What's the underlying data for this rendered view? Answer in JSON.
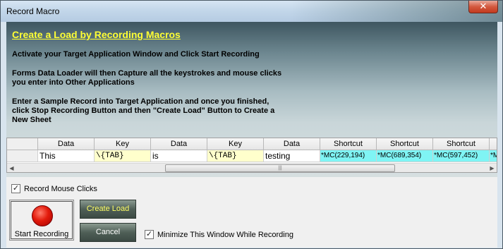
{
  "window": {
    "title": "Record Macro",
    "close_glyph": "✕"
  },
  "banner": {
    "heading": "Create a Load by Recording Macros",
    "line1": "Activate your Target Application Window and Click Start Recording",
    "line2a": "Forms Data Loader will then Capture all the keystrokes and mouse clicks",
    "line2b": "you enter into Other Applications",
    "line3a": "Enter a Sample Record into Target Application and once you finished,",
    "line3b": "click Stop Recording Button and then \"Create Load\" Button to Create a",
    "line3c": "New Sheet"
  },
  "grid": {
    "headers": [
      "Data",
      "Key",
      "Data",
      "Key",
      "Data",
      "Shortcut",
      "Shortcut",
      "Shortcut"
    ],
    "row": [
      "This",
      "\\{TAB}",
      "is",
      "\\{TAB}",
      "testing",
      "*MC(229,194)",
      "*MC(689,354)",
      "*MC(597,452)",
      "*M"
    ],
    "scroll_left": "◀",
    "scroll_right": "▶",
    "scroll_grip": "|||"
  },
  "options": {
    "record_mouse_clicks": "Record Mouse Clicks",
    "record_mouse_checked": "✓",
    "minimize_label": "Minimize This Window While Recording",
    "minimize_checked": "✓"
  },
  "buttons": {
    "start_recording": "Start Recording",
    "create_load": "Create Load",
    "cancel": "Cancel"
  },
  "colors": {
    "heading": "#ffff33",
    "key_cell": "#ffffcc",
    "shortcut_cell": "#7ff4f4",
    "create_load_text": "#ffff66",
    "cancel_text": "#ffffff",
    "record_dot": "#e31b0c"
  }
}
